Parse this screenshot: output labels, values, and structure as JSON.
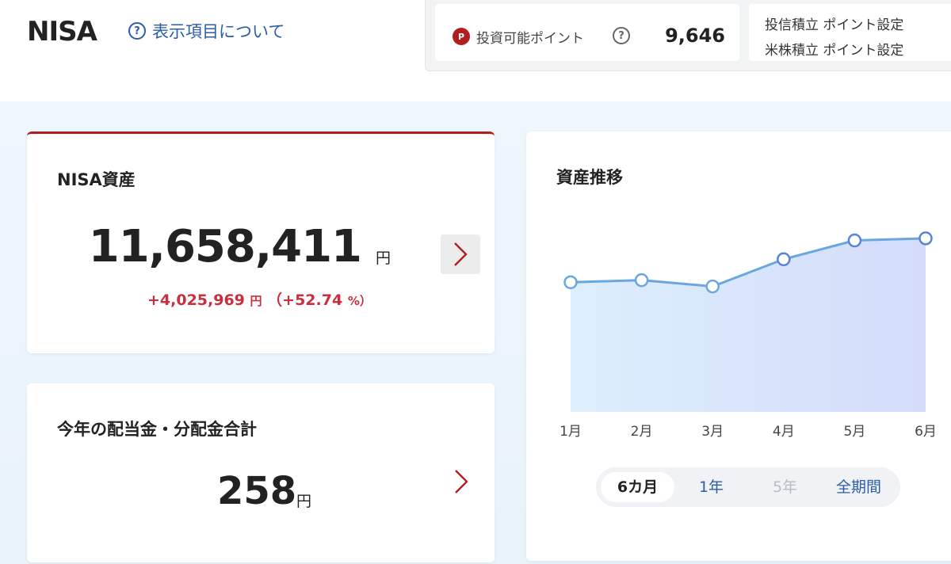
{
  "header": {
    "title": "NISA",
    "help_link": "表示項目について",
    "points": {
      "badge": "P",
      "label": "投資可能ポイント",
      "value": "9,646"
    },
    "settings": [
      "投信積立 ポイント設定",
      "米株積立 ポイント設定"
    ]
  },
  "asset_card": {
    "title": "NISA資産",
    "value": "11,658,411",
    "unit": "円",
    "change_amount": "+4,025,969",
    "change_unit": "円",
    "change_percent_open": "（+52.74",
    "change_percent_unit": "%）"
  },
  "dividend_card": {
    "title": "今年の配当金・分配金合計",
    "value": "258",
    "unit": "円"
  },
  "chart_card": {
    "title": "資産推移",
    "tabs": [
      {
        "label": "6カ月",
        "state": "active"
      },
      {
        "label": "1年",
        "state": "normal"
      },
      {
        "label": "5年",
        "state": "disabled"
      },
      {
        "label": "全期間",
        "state": "normal"
      }
    ]
  },
  "chart_data": {
    "type": "area",
    "categories": [
      "1月",
      "2月",
      "3月",
      "4月",
      "5月",
      "6月"
    ],
    "values": [
      0.62,
      0.63,
      0.6,
      0.73,
      0.82,
      0.83
    ],
    "ylim": [
      0,
      1
    ],
    "grid": false,
    "colors": {
      "line": "#6aa6e0",
      "fill_start": "#ddeefc",
      "fill_end": "#d4dcfa",
      "marker_border": "#6aa6e0"
    }
  }
}
